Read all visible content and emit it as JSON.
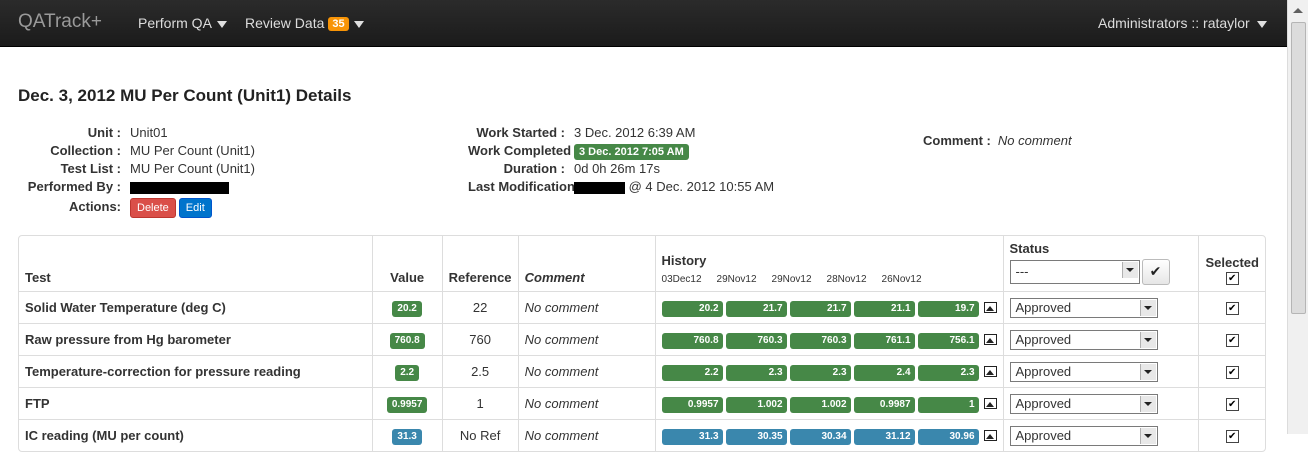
{
  "navbar": {
    "brand": "QATrack+",
    "perform_qa": "Perform QA",
    "review_data": "Review Data",
    "review_badge": "35",
    "user": "Administrators :: rataylor"
  },
  "page_title": "Dec. 3, 2012 MU Per Count (Unit1) Details",
  "details": {
    "unit_label": "Unit :",
    "unit": "Unit01",
    "collection_label": "Collection :",
    "collection": "MU Per Count (Unit1)",
    "test_list_label": "Test List :",
    "test_list": "MU Per Count (Unit1)",
    "performed_by_label": "Performed By :",
    "actions_label": "Actions:",
    "delete": "Delete",
    "edit": "Edit",
    "work_started_label": "Work Started :",
    "work_started": "3 Dec. 2012 6:39 AM",
    "work_completed_label": "Work Completed :",
    "work_completed": "3 Dec. 2012 7:05 AM",
    "duration_label": "Duration :",
    "duration": "0d 0h 26m 17s",
    "last_mod_label": "Last Modification :",
    "last_mod": "@ 4 Dec. 2012 10:55 AM",
    "comment_label": "Comment :",
    "comment": "No comment"
  },
  "table": {
    "headers": {
      "test": "Test",
      "value": "Value",
      "reference": "Reference",
      "comment": "Comment",
      "history": "History",
      "status": "Status",
      "selected": "Selected"
    },
    "history_dates": [
      "03Dec12",
      "29Nov12",
      "29Nov12",
      "28Nov12",
      "26Nov12"
    ],
    "status_filter": "---",
    "check_icon": "✔",
    "rows": [
      {
        "test": "Solid Water Temperature (deg C)",
        "value": "20.2",
        "reference": "22",
        "comment": "No comment",
        "history": [
          "20.2",
          "21.7",
          "21.7",
          "21.1",
          "19.7"
        ],
        "status": "Approved",
        "checked": "✔"
      },
      {
        "test": "Raw pressure from Hg barometer",
        "value": "760.8",
        "reference": "760",
        "comment": "No comment",
        "history": [
          "760.8",
          "760.3",
          "760.3",
          "761.1",
          "756.1"
        ],
        "status": "Approved",
        "checked": "✔"
      },
      {
        "test": "Temperature-correction for pressure reading",
        "value": "2.2",
        "reference": "2.5",
        "comment": "No comment",
        "history": [
          "2.2",
          "2.3",
          "2.3",
          "2.4",
          "2.3"
        ],
        "status": "Approved",
        "checked": "✔"
      },
      {
        "test": "FTP",
        "value": "0.9957",
        "reference": "1",
        "comment": "No comment",
        "history": [
          "0.9957",
          "1.002",
          "1.002",
          "0.9987",
          "1"
        ],
        "status": "Approved",
        "checked": "✔"
      },
      {
        "test": "IC reading (MU per count)",
        "value": "31.3",
        "reference": "No Ref",
        "comment": "No comment",
        "history": [
          "31.3",
          "30.35",
          "30.34",
          "31.12",
          "30.96"
        ],
        "status": "Approved",
        "checked": "✔"
      }
    ]
  },
  "colors": {
    "ok": "#468847",
    "info": "#3a87ad",
    "badge": "#f89406",
    "navbar": "#1b1b1b"
  }
}
